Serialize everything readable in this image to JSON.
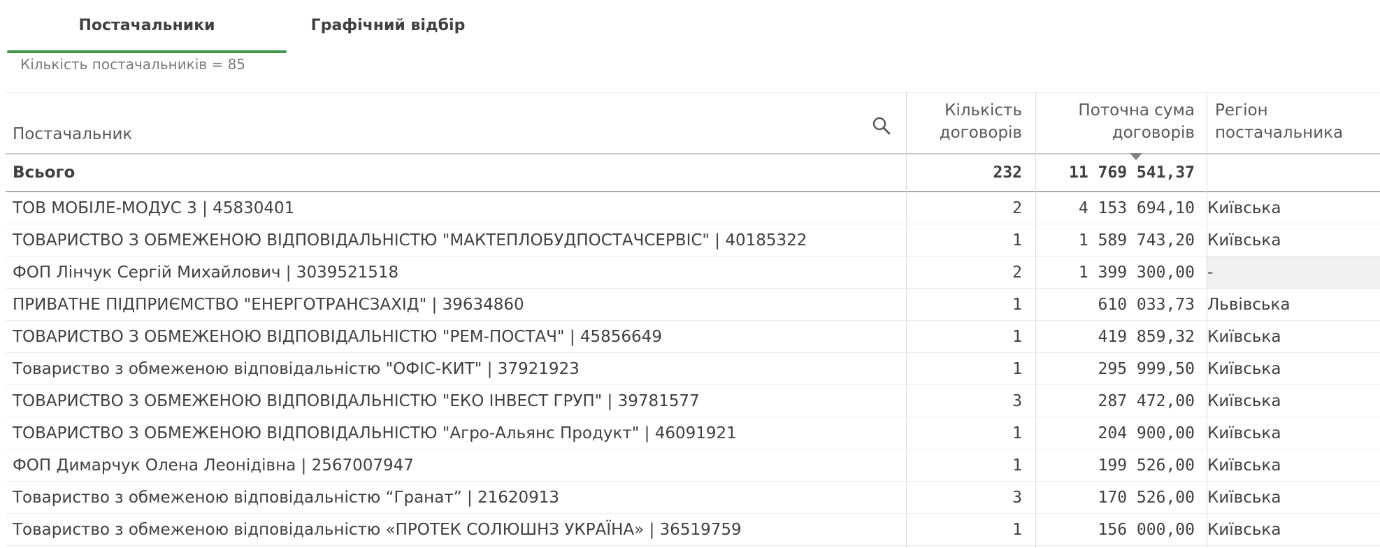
{
  "tabs": [
    {
      "label": "Постачальники",
      "active": true
    },
    {
      "label": "Графічний відбір",
      "active": false
    }
  ],
  "count_label": "Кількість постачальників = 85",
  "colors": {
    "accent": "#3f9b48"
  },
  "table": {
    "headers": {
      "supplier": "Постачальник",
      "contracts_line1": "Кількість",
      "contracts_line2": "договорів",
      "sum_line1": "Поточна сума",
      "sum_line2": "договорів",
      "region_line1": "Регіон",
      "region_line2": "постачальника"
    },
    "total": {
      "label": "Всього",
      "contracts": "232",
      "sum": "11 769 541,37",
      "region": ""
    },
    "rows": [
      {
        "name": "ТОВ МОБІЛЕ-МОДУС 3 | 45830401",
        "contracts": "2",
        "sum": "4 153 694,10",
        "region": "Київська"
      },
      {
        "name": "ТОВАРИСТВО З ОБМЕЖЕНОЮ ВІДПОВІДАЛЬНІСТЮ \"МАКТЕПЛОБУДПОСТАЧСЕРВІС\" | 40185322",
        "contracts": "1",
        "sum": "1 589 743,20",
        "region": "Київська"
      },
      {
        "name": "ФОП Лінчук Сергій Михайлович | 3039521518",
        "contracts": "2",
        "sum": "1 399 300,00",
        "region": "-"
      },
      {
        "name": "ПРИВАТНЕ ПІДПРИЄМСТВО \"ЕНЕРГОТРАНСЗАХІД\" | 39634860",
        "contracts": "1",
        "sum": "610 033,73",
        "region": "Львівська"
      },
      {
        "name": "ТОВАРИСТВО З ОБМЕЖЕНОЮ ВІДПОВІДАЛЬНІСТЮ \"РЕМ-ПОСТАЧ\" | 45856649",
        "contracts": "1",
        "sum": "419 859,32",
        "region": "Київська"
      },
      {
        "name": "Товариство з обмеженою відповідальністю \"ОФІС-КИТ\" | 37921923",
        "contracts": "1",
        "sum": "295 999,50",
        "region": "Київська"
      },
      {
        "name": "ТОВАРИСТВО З ОБМЕЖЕНОЮ ВІДПОВІДАЛЬНІСТЮ \"ЕКО ІНВЕСТ ГРУП\" | 39781577",
        "contracts": "3",
        "sum": "287 472,00",
        "region": "Київська"
      },
      {
        "name": "ТОВАРИСТВО З ОБМЕЖЕНОЮ ВІДПОВІДАЛЬНІСТЮ \"Агро-Альянс Продукт\" | 46091921",
        "contracts": "1",
        "sum": "204 900,00",
        "region": "Київська"
      },
      {
        "name": "ФОП Димарчук Олена Леонідівна | 2567007947",
        "contracts": "1",
        "sum": "199 526,00",
        "region": "Київська"
      },
      {
        "name": "Товариство з обмеженою відповідальністю “Гранат” | 21620913",
        "contracts": "3",
        "sum": "170 526,00",
        "region": "Київська"
      },
      {
        "name": "Товариство з обмеженою відповідальністю «ПРОТЕК СОЛЮШНЗ УКРАЇНА» | 36519759",
        "contracts": "1",
        "sum": "156 000,00",
        "region": "Київська"
      }
    ]
  }
}
